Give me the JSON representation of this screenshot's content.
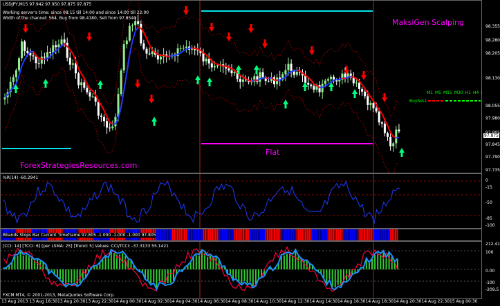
{
  "window": {
    "symbol_title": "USDJPY,M15",
    "quote_line": "97.942 97.950 97.875 97.875"
  },
  "info": {
    "line1": "Working server's time: since 08:15 till 14:00 and since 14:00 till 22:00",
    "line2": "Width of the channel: 564, Buy from 98.4180, Sell from 97.8540"
  },
  "overlay": {
    "brand_title": "MaksiGen Scalping",
    "flat_label": "Flat",
    "watermark": "ForexStrategiesResources.com",
    "buysell_label": "BuySeLL",
    "timeframes": [
      "M1",
      "M5",
      "M15",
      "M30",
      "H1",
      "H4",
      "D1"
    ]
  },
  "price_scale": {
    "ticks": [
      "98.355",
      "98.280",
      "98.205",
      "98.130",
      "98.055",
      "97.980",
      "97.905",
      "97.845",
      "97.790",
      "97.735"
    ],
    "current": "97.875"
  },
  "williams": {
    "label": "%R(14) -60.2941",
    "ticks": [
      "0",
      "-15",
      "-50",
      "-85",
      "-100"
    ]
  },
  "bbands": {
    "label": "Bbands Stops Bar",
    "timeframe_label": "Current Timeframe",
    "values": "97.805 -1.000 -1.000 -1.000 97.805"
  },
  "cci": {
    "label": "[CCI: 14] [TCCI: 6] [per LSMA: 25] [Trend: 5] Values: CCI/TCCI: -37.3133 55.1421",
    "ticks": [
      "212.4141",
      "100",
      "0.00",
      "-100",
      "-209.5"
    ]
  },
  "copyright": "FXCM MT4, © 2001-2013, MetaQuotes Software Corp.",
  "time_axis": [
    "13 Aug 2013",
    "13 Aug 18:30",
    "13 Aug 20:30",
    "13 Aug 22:30",
    "14 Aug 00:30",
    "14 Aug 02:30",
    "14 Aug 04:30",
    "14 Aug 06:30",
    "14 Aug 08:30",
    "14 Aug 10:30",
    "14 Aug 12:30",
    "14 Aug 14:30",
    "14 Aug 16:30",
    "14 Aug 18:30",
    "14 Aug 20:30",
    "14 Aug 22:30",
    "15 Aug 00:30"
  ],
  "colors": {
    "bull_candle": "#90ee90",
    "bear_candle": "#ffffff",
    "up_arrow": "#00ff7f",
    "down_arrow": "#ff0000",
    "ma_red": "#ff0000",
    "ma_blue": "#1e3cff",
    "channel": "#8b0000",
    "cyan_line": "#00e5ee",
    "magenta": "#ff00ff",
    "wpr_line": "#1e3cff",
    "bbands_red": "#ff0000",
    "bbands_blue": "#0000ff",
    "cci_green": "#32cd32",
    "cci_red": "#ff0040",
    "cci_blue": "#1e90ff",
    "watermark": "#ff00ff"
  }
}
